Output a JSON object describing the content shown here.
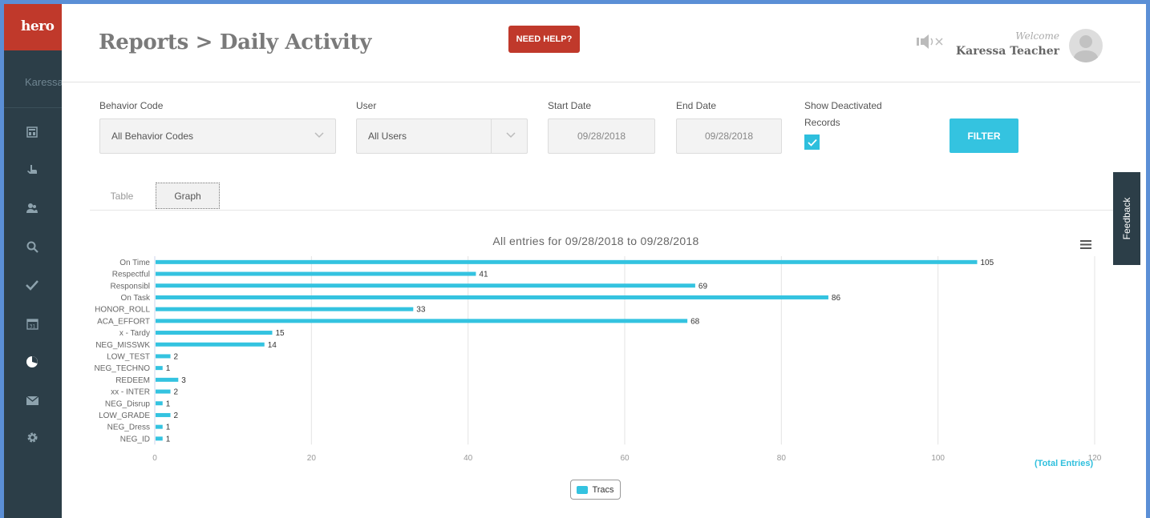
{
  "app": {
    "logo": "hero",
    "sidebar_user": "Karessa Teacher"
  },
  "header": {
    "title": "Reports > Daily Activity",
    "help_label": "NEED HELP?",
    "welcome": "Welcome",
    "user_name": "Karessa Teacher"
  },
  "sidebar": {
    "items": [
      {
        "icon": "dashboard-icon"
      },
      {
        "icon": "hand-icon"
      },
      {
        "icon": "students-icon"
      },
      {
        "icon": "search-icon"
      },
      {
        "icon": "check-icon"
      },
      {
        "icon": "calendar-icon"
      },
      {
        "icon": "pie-chart-icon"
      },
      {
        "icon": "mail-icon"
      },
      {
        "icon": "gear-icon"
      }
    ]
  },
  "filters": {
    "behavior_label": "Behavior Code",
    "behavior_value": "All Behavior Codes",
    "user_label": "User",
    "user_value": "All Users",
    "start_label": "Start Date",
    "start_value": "09/28/2018",
    "end_label": "End Date",
    "end_value": "09/28/2018",
    "deactivated_label_1": "Show Deactivated",
    "deactivated_label_2": "Records",
    "deactivated_checked": true,
    "filter_button": "FILTER"
  },
  "tabs": {
    "table": "Table",
    "graph": "Graph",
    "active": "Graph"
  },
  "feedback": "Feedback",
  "colors": {
    "accent": "#34c3e0",
    "danger": "#c0392b",
    "sidebar": "#2c3e48"
  },
  "chart_data": {
    "type": "bar",
    "orientation": "horizontal",
    "title": "All entries for 09/28/2018 to 09/28/2018",
    "categories": [
      "On Time",
      "Respectful",
      "Responsibl",
      "On Task",
      "HONOR_ROLL",
      "ACA_EFFORT",
      "x - Tardy",
      "NEG_MISSWK",
      "LOW_TEST",
      "NEG_TECHNO",
      "REDEEM",
      "xx - INTER",
      "NEG_Disrup",
      "LOW_GRADE",
      "NEG_Dress",
      "NEG_ID"
    ],
    "series": [
      {
        "name": "Tracs",
        "values": [
          105,
          41,
          69,
          86,
          33,
          68,
          15,
          14,
          2,
          1,
          3,
          2,
          1,
          2,
          1,
          1
        ]
      }
    ],
    "xlim": [
      0,
      120
    ],
    "xticks": [
      0,
      20,
      40,
      60,
      80,
      100,
      120
    ],
    "value_axis_label": "(Total Entries)",
    "grid": true,
    "legend": "bottom-center"
  }
}
